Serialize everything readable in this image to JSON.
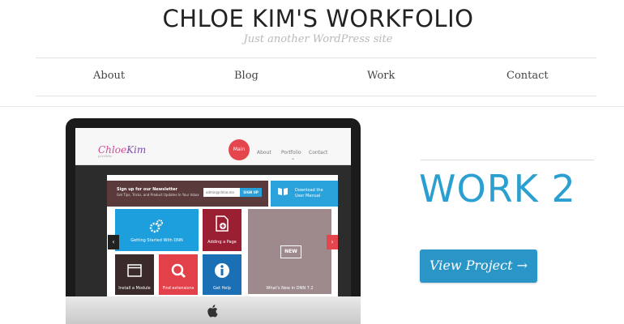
{
  "site": {
    "title": "CHLOE KIM'S WORKFOLIO",
    "tagline": "Just another WordPress site"
  },
  "nav": {
    "items": [
      "About",
      "Blog",
      "Work",
      "Contact"
    ]
  },
  "project": {
    "title": "WORK 2",
    "button_label": "View Project →"
  },
  "preview": {
    "logo_first": "Chloe",
    "logo_last": "Kim",
    "logo_tagline": "portfolio",
    "nav": [
      "Main",
      "About",
      "Portfolio",
      "Contact"
    ],
    "newsletter_title": "Sign up for our Newsletter",
    "newsletter_sub": "Get Tips, Tricks, and Product Updates In Your Inbox",
    "email_value": "admin@chloe.me",
    "signup_label": "SIGN UP",
    "manual_line1": "Download the",
    "manual_line2": "User Manual",
    "tiles": [
      "Getting Started With DNN",
      "Adding a Page",
      "What's New in DNN 7.2",
      "Install a Module",
      "Find extensions",
      "Get Help"
    ],
    "new_badge": "NEW",
    "prev_arrow": "‹",
    "next_arrow": "›"
  },
  "colors": {
    "accent": "#2ba0d0",
    "button": "#2a96c8",
    "main_nav": "#e5454c"
  }
}
